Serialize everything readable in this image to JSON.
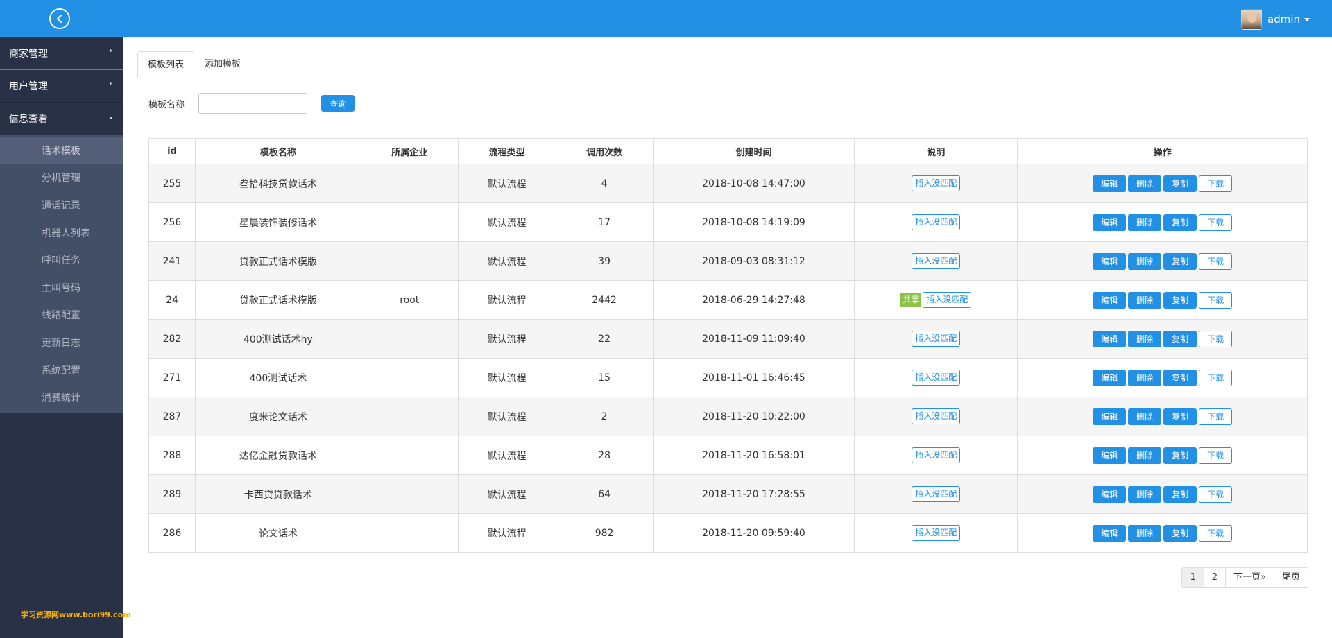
{
  "header": {
    "user_name": "admin"
  },
  "sidebar": {
    "groups": [
      {
        "label": "商家管理"
      },
      {
        "label": "用户管理"
      },
      {
        "label": "信息查看"
      }
    ],
    "sub_items": [
      {
        "label": "话术模板"
      },
      {
        "label": "分机管理"
      },
      {
        "label": "通话记录"
      },
      {
        "label": "机器人列表"
      },
      {
        "label": "呼叫任务"
      },
      {
        "label": "主叫号码"
      },
      {
        "label": "线路配置"
      },
      {
        "label": "更新日志"
      },
      {
        "label": "系统配置"
      },
      {
        "label": "消费统计"
      }
    ],
    "watermark": "学习资源网www.bori99.com"
  },
  "tabs": [
    {
      "label": "模板列表"
    },
    {
      "label": "添加模板"
    }
  ],
  "search": {
    "label": "模板名称",
    "value": "",
    "placeholder": "",
    "button": "查询"
  },
  "table": {
    "columns": [
      "id",
      "模板名称",
      "所属企业",
      "流程类型",
      "调用次数",
      "创建时间",
      "说明",
      "操作"
    ],
    "desc_button": "插入没匹配",
    "share_badge": "共享",
    "actions": {
      "edit": "编辑",
      "delete": "删除",
      "copy": "复制",
      "download": "下载"
    },
    "rows": [
      {
        "id": "255",
        "name": "叁拾科技贷款话术",
        "company": "",
        "flow": "默认流程",
        "calls": "4",
        "created": "2018-10-08 14:47:00",
        "shared": false
      },
      {
        "id": "256",
        "name": "星晨装饰装修话术",
        "company": "",
        "flow": "默认流程",
        "calls": "17",
        "created": "2018-10-08 14:19:09",
        "shared": false
      },
      {
        "id": "241",
        "name": "贷款正式话术模版",
        "company": "",
        "flow": "默认流程",
        "calls": "39",
        "created": "2018-09-03 08:31:12",
        "shared": false
      },
      {
        "id": "24",
        "name": "贷款正式话术模版",
        "company": "root",
        "flow": "默认流程",
        "calls": "2442",
        "created": "2018-06-29 14:27:48",
        "shared": true
      },
      {
        "id": "282",
        "name": "400测试话术hy",
        "company": "",
        "flow": "默认流程",
        "calls": "22",
        "created": "2018-11-09 11:09:40",
        "shared": false
      },
      {
        "id": "271",
        "name": "400测试话术",
        "company": "",
        "flow": "默认流程",
        "calls": "15",
        "created": "2018-11-01 16:46:45",
        "shared": false
      },
      {
        "id": "287",
        "name": "度米论文话术",
        "company": "",
        "flow": "默认流程",
        "calls": "2",
        "created": "2018-11-20 10:22:00",
        "shared": false
      },
      {
        "id": "288",
        "name": "达亿金融贷款话术",
        "company": "",
        "flow": "默认流程",
        "calls": "28",
        "created": "2018-11-20 16:58:01",
        "shared": false
      },
      {
        "id": "289",
        "name": "卡西贷贷款话术",
        "company": "",
        "flow": "默认流程",
        "calls": "64",
        "created": "2018-11-20 17:28:55",
        "shared": false
      },
      {
        "id": "286",
        "name": "论文话术",
        "company": "",
        "flow": "默认流程",
        "calls": "982",
        "created": "2018-11-20 09:59:40",
        "shared": false
      }
    ]
  },
  "pagination": {
    "pages": [
      "1",
      "2"
    ],
    "next": "下一页»",
    "last": "尾页"
  },
  "colors": {
    "primary": "#2190e5",
    "sidebar_bg": "#293146",
    "submenu_bg": "#434e67",
    "share_green": "#8bc34a"
  }
}
